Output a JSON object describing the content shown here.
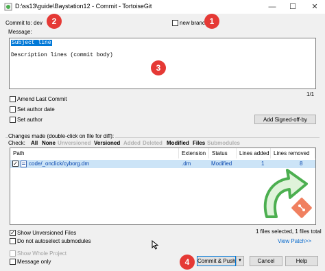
{
  "window": {
    "title": "D:\\ss13\\guide\\Baystation12 - Commit - TortoiseGit",
    "minimize": "—",
    "maximize": "☐",
    "close": "✕"
  },
  "commit_to": {
    "label": "Commit to:",
    "branch": "dev"
  },
  "new_branch": {
    "label": "new branch",
    "checked": false
  },
  "message": {
    "label": "Message:",
    "subject": "Subject line",
    "body": "Description lines (commit body)",
    "line_counter": "1/1"
  },
  "options": {
    "amend": "Amend Last Commit",
    "set_author_date": "Set author date",
    "set_author": "Set author",
    "signed_off": "Add Signed-off-by"
  },
  "changes": {
    "label": "Changes made (double-click on file for diff):",
    "check_label": "Check:",
    "filters": [
      "All",
      "None",
      "Unversioned",
      "Versioned",
      "Added",
      "Deleted",
      "Modified",
      "Files",
      "Submodules"
    ],
    "columns": [
      "Path",
      "Extension",
      "Status",
      "Lines added",
      "Lines removed"
    ],
    "rows": [
      {
        "path": "code/_onclick/cyborg.dm",
        "extension": ".dm",
        "status": "Modified",
        "added": "1",
        "removed": "8",
        "checked": true
      }
    ]
  },
  "bottom": {
    "show_unversioned": "Show Unversioned Files",
    "no_autoselect": "Do not autoselect submodules",
    "files_selected": "1 files selected, 1 files total",
    "view_patch": "View Patch>>",
    "show_whole_project": "Show Whole Project",
    "message_only": "Message only"
  },
  "buttons": {
    "commit_push": "Commit & Push",
    "dropdown": "▼",
    "cancel": "Cancel",
    "help": "Help"
  },
  "badges": [
    "1",
    "2",
    "3",
    "4"
  ],
  "colors": {
    "badge": "#e53935",
    "selection": "#cce4f7",
    "link": "#0066cc",
    "logo": "#4caf50"
  }
}
